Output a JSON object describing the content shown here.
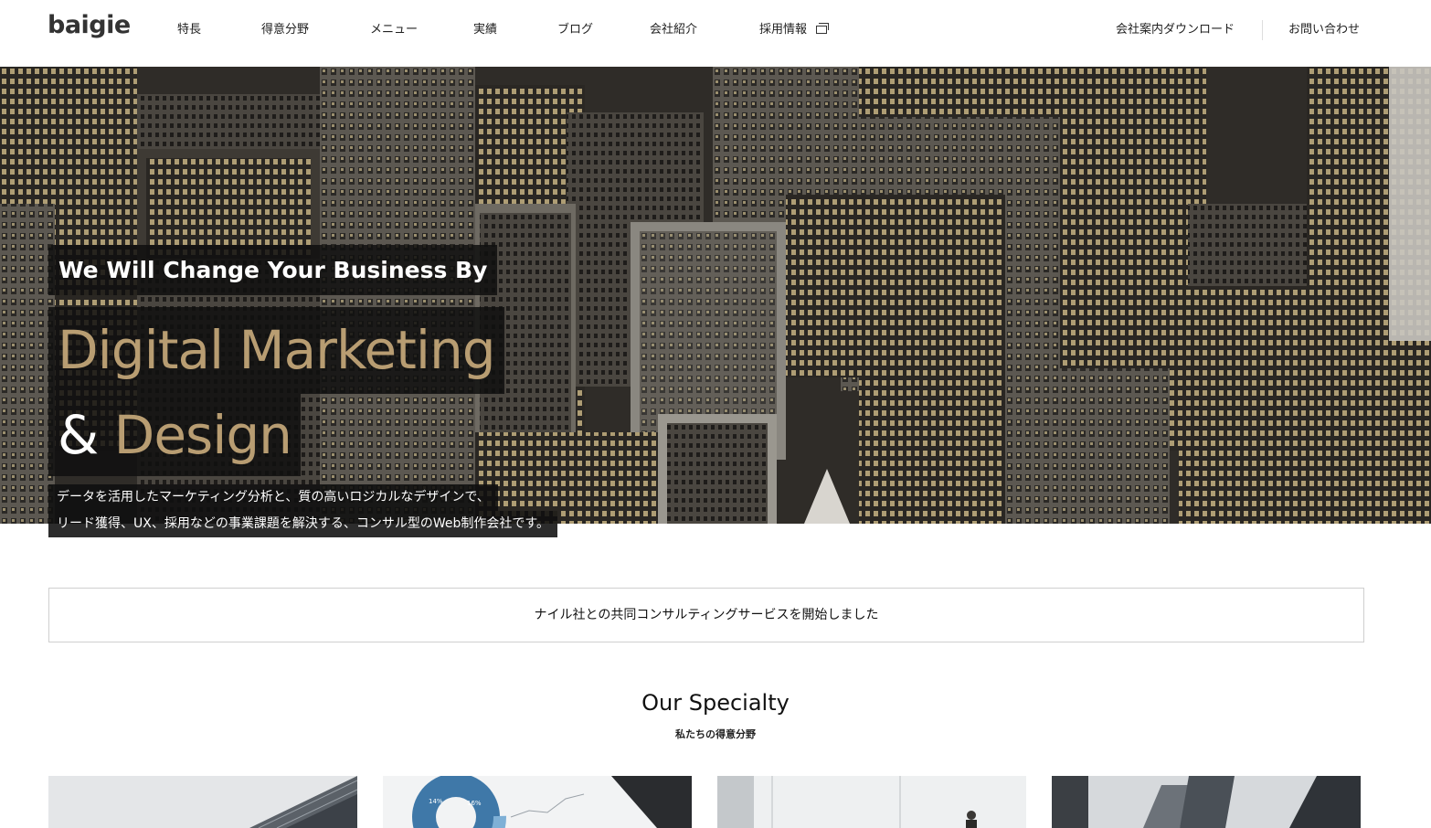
{
  "header": {
    "logo": "baigie",
    "nav": [
      "特長",
      "得意分野",
      "メニュー",
      "実績",
      "ブログ",
      "会社紹介",
      "採用情報"
    ],
    "download_label": "会社案内ダウンロード",
    "contact_label": "お問い合わせ"
  },
  "hero": {
    "line1": "We Will Change Your Business By",
    "line2": "Digital Marketing",
    "line3_amp": "&",
    "line3_word": "Design",
    "sub1": "データを活用したマーケティング分析と、質の高いロジカルなデザインで、",
    "sub2": "リード獲得、UX、採用などの事業課題を解決する、コンサル型のWeb制作会社です。",
    "accent_color": "#b89d72"
  },
  "notice": {
    "text": "ナイル社との共同コンサルティングサービスを開始しました"
  },
  "specialty": {
    "title": "Our Specialty",
    "subtitle": "私たちの得意分野",
    "chart_labels": [
      "14%",
      "16%"
    ]
  }
}
